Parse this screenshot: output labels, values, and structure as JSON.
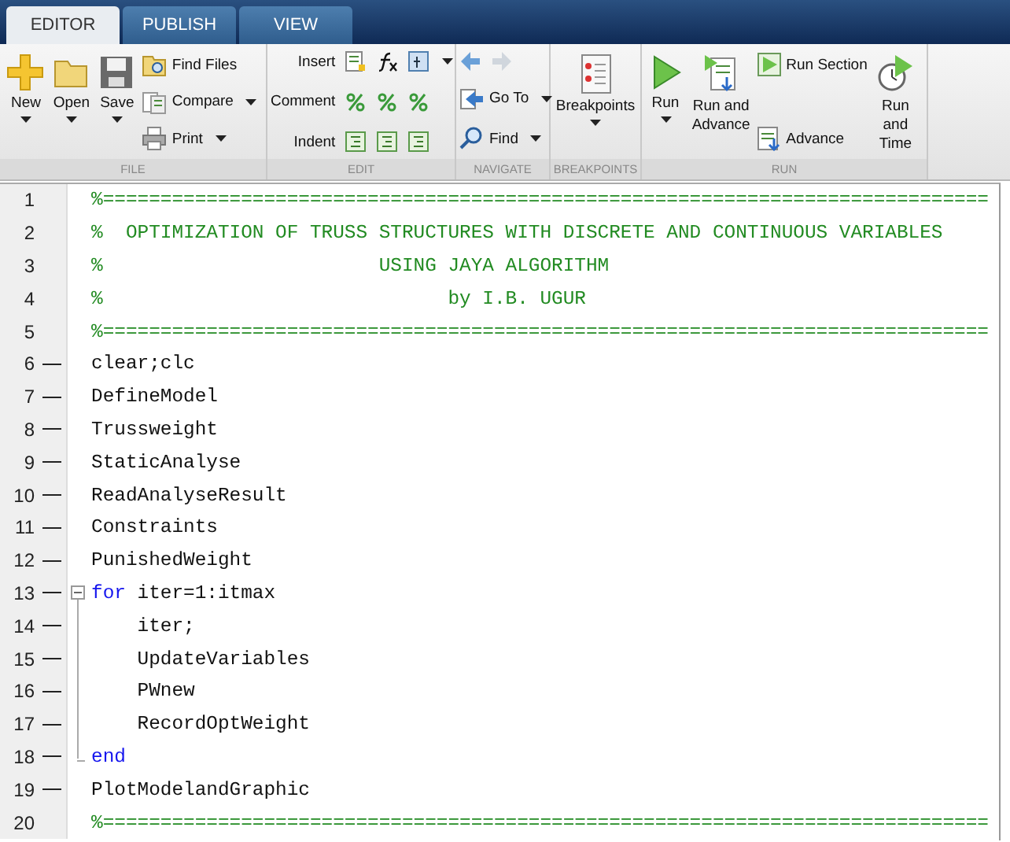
{
  "tabs": [
    {
      "label": "EDITOR",
      "selected": true
    },
    {
      "label": "PUBLISH",
      "selected": false
    },
    {
      "label": "VIEW",
      "selected": false
    }
  ],
  "ribbon": [
    {
      "label": "FILE",
      "columns": [
        {
          "kind": "large",
          "label": "New",
          "dropdown": true
        },
        {
          "kind": "large",
          "label": "Open",
          "dropdown": true
        },
        {
          "kind": "large",
          "label": "Save",
          "dropdown": true
        },
        {
          "kind": "stack",
          "items": [
            {
              "label": "Find Files",
              "dropdown": false
            },
            {
              "label": "Compare",
              "dropdown": true
            },
            {
              "label": "Print",
              "dropdown": true
            }
          ]
        }
      ]
    },
    {
      "label": "EDIT",
      "columns": [
        {
          "kind": "iconrows",
          "rows": [
            {
              "label": "Insert",
              "dropdown": true
            },
            {
              "label": "Comment",
              "dropdown": false
            },
            {
              "label": "Indent",
              "dropdown": false
            }
          ]
        }
      ]
    },
    {
      "label": "NAVIGATE",
      "columns": [
        {
          "kind": "navstack",
          "items": [
            {
              "label": "Go To",
              "dropdown": true
            },
            {
              "label": "Find",
              "dropdown": true
            }
          ]
        }
      ]
    },
    {
      "label": "BREAKPOINTS",
      "columns": [
        {
          "kind": "large",
          "label": "Breakpoints",
          "dropdown": true
        }
      ]
    },
    {
      "label": "RUN",
      "columns": [
        {
          "kind": "large",
          "label": "Run",
          "dropdown": true
        },
        {
          "kind": "large",
          "label": "Run and Advance",
          "dropdown": false
        },
        {
          "kind": "stack",
          "items": [
            {
              "label": "Run Section",
              "dropdown": false
            },
            {
              "label": "Advance",
              "dropdown": false
            }
          ]
        },
        {
          "kind": "large",
          "label": "Run and Time",
          "dropdown": false
        }
      ]
    }
  ],
  "lines": [
    {
      "number": "1",
      "kind": "plain",
      "executable": false,
      "segments": [
        {
          "kind": "comment",
          "text": "%============================================================================="
        }
      ]
    },
    {
      "number": "2",
      "kind": "plain",
      "executable": false,
      "segments": [
        {
          "kind": "comment",
          "text": "%  OPTIMIZATION OF TRUSS STRUCTURES WITH DISCRETE AND CONTINUOUS VARIABLES"
        }
      ]
    },
    {
      "number": "3",
      "kind": "plain",
      "executable": false,
      "segments": [
        {
          "kind": "comment",
          "text": "%                        USING JAYA ALGORITHM"
        }
      ]
    },
    {
      "number": "4",
      "kind": "plain",
      "executable": false,
      "segments": [
        {
          "kind": "comment",
          "text": "%                              by I.B. UGUR"
        }
      ]
    },
    {
      "number": "5",
      "kind": "plain",
      "executable": false,
      "segments": [
        {
          "kind": "comment",
          "text": "%============================================================================="
        }
      ]
    },
    {
      "number": "6",
      "kind": "plain",
      "executable": true,
      "segments": [
        {
          "kind": "plain",
          "text": "clear;clc"
        }
      ]
    },
    {
      "number": "7",
      "kind": "plain",
      "executable": true,
      "segments": [
        {
          "kind": "plain",
          "text": "DefineModel"
        }
      ]
    },
    {
      "number": "8",
      "kind": "plain",
      "executable": true,
      "segments": [
        {
          "kind": "plain",
          "text": "Trussweight"
        }
      ]
    },
    {
      "number": "9",
      "kind": "plain",
      "executable": true,
      "segments": [
        {
          "kind": "plain",
          "text": "StaticAnalyse"
        }
      ]
    },
    {
      "number": "10",
      "kind": "plain",
      "executable": true,
      "segments": [
        {
          "kind": "plain",
          "text": "ReadAnalyseResult"
        }
      ]
    },
    {
      "number": "11",
      "kind": "plain",
      "executable": true,
      "segments": [
        {
          "kind": "plain",
          "text": "Constraints"
        }
      ]
    },
    {
      "number": "12",
      "kind": "plain",
      "executable": true,
      "segments": [
        {
          "kind": "plain",
          "text": "PunishedWeight"
        }
      ]
    },
    {
      "number": "13",
      "kind": "open",
      "executable": true,
      "segments": [
        {
          "kind": "keyword",
          "text": "for"
        },
        {
          "kind": "plain",
          "text": " iter=1:itmax"
        }
      ]
    },
    {
      "number": "14",
      "kind": "inner",
      "executable": true,
      "segments": [
        {
          "kind": "plain",
          "text": "    iter;"
        }
      ]
    },
    {
      "number": "15",
      "kind": "inner",
      "executable": true,
      "segments": [
        {
          "kind": "plain",
          "text": "    UpdateVariables"
        }
      ]
    },
    {
      "number": "16",
      "kind": "inner",
      "executable": true,
      "segments": [
        {
          "kind": "plain",
          "text": "    PWnew"
        }
      ]
    },
    {
      "number": "17",
      "kind": "inner",
      "executable": true,
      "segments": [
        {
          "kind": "plain",
          "text": "    RecordOptWeight"
        }
      ]
    },
    {
      "number": "18",
      "kind": "close",
      "executable": true,
      "segments": [
        {
          "kind": "keyword",
          "text": "end"
        }
      ]
    },
    {
      "number": "19",
      "kind": "plain",
      "executable": true,
      "segments": [
        {
          "kind": "plain",
          "text": "PlotModelandGraphic"
        }
      ]
    },
    {
      "number": "20",
      "kind": "plain",
      "executable": false,
      "segments": [
        {
          "kind": "comment",
          "text": "%============================================================================="
        }
      ]
    }
  ]
}
